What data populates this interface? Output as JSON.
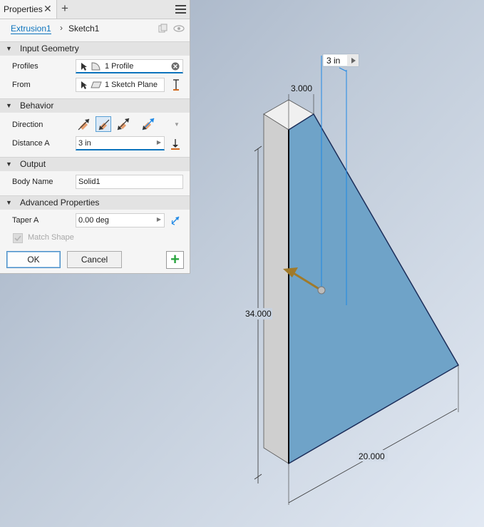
{
  "panel": {
    "tab_label": "Properties",
    "breadcrumb": {
      "parent": "Extrusion1",
      "separator": "›",
      "current": "Sketch1"
    },
    "sections": {
      "input_geometry": "Input Geometry",
      "behavior": "Behavior",
      "output": "Output",
      "advanced": "Advanced Properties"
    },
    "fields": {
      "profiles_label": "Profiles",
      "profiles_value": "1 Profile",
      "from_label": "From",
      "from_value": "1 Sketch Plane",
      "direction_label": "Direction",
      "distance_label": "Distance A",
      "distance_value": "3 in",
      "body_name_label": "Body Name",
      "body_name_value": "Solid1",
      "taper_label": "Taper A",
      "taper_value": "0.00 deg",
      "match_shape_label": "Match Shape"
    },
    "buttons": {
      "ok": "OK",
      "cancel": "Cancel",
      "add": "+"
    }
  },
  "viewport": {
    "dim_top": "3.000",
    "dim_height": "34.000",
    "dim_bottom": "20.000",
    "distance_tag": "3 in"
  },
  "colors": {
    "accent": "#0d74bd",
    "face": "#6fa3c8",
    "face_edge": "#1c2e5a",
    "arrow": "#a07a2a",
    "add_green": "#2aa43f"
  }
}
